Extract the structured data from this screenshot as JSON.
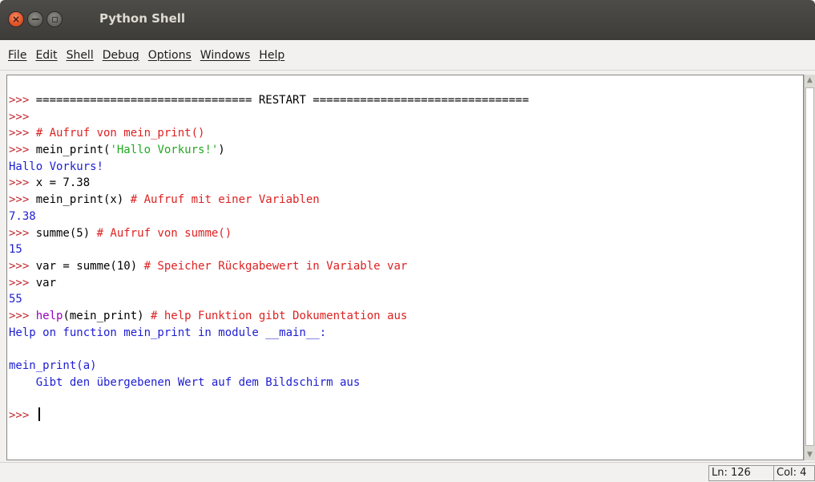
{
  "window": {
    "title": "Python Shell",
    "controls": {
      "close_glyph": "×"
    }
  },
  "menu": [
    {
      "label": "File"
    },
    {
      "label": "Edit"
    },
    {
      "label": "Shell"
    },
    {
      "label": "Debug"
    },
    {
      "label": "Options"
    },
    {
      "label": "Windows"
    },
    {
      "label": "Help"
    }
  ],
  "shell": {
    "lines": [
      [
        {
          "t": ">>> ",
          "c": "prompt"
        },
        {
          "t": "================================ RESTART ================================",
          "c": "code"
        }
      ],
      [
        {
          "t": ">>> ",
          "c": "prompt"
        }
      ],
      [
        {
          "t": ">>> ",
          "c": "prompt"
        },
        {
          "t": "# Aufruf von mein_print()",
          "c": "comment"
        }
      ],
      [
        {
          "t": ">>> ",
          "c": "prompt"
        },
        {
          "t": "mein_print(",
          "c": "code"
        },
        {
          "t": "'Hallo Vorkurs!'",
          "c": "string"
        },
        {
          "t": ")",
          "c": "code"
        }
      ],
      [
        {
          "t": "Hallo Vorkurs!",
          "c": "output"
        }
      ],
      [
        {
          "t": ">>> ",
          "c": "prompt"
        },
        {
          "t": "x = 7.38",
          "c": "code"
        }
      ],
      [
        {
          "t": ">>> ",
          "c": "prompt"
        },
        {
          "t": "mein_print(x) ",
          "c": "code"
        },
        {
          "t": "# Aufruf mit einer Variablen",
          "c": "comment"
        }
      ],
      [
        {
          "t": "7.38",
          "c": "output"
        }
      ],
      [
        {
          "t": ">>> ",
          "c": "prompt"
        },
        {
          "t": "summe(5) ",
          "c": "code"
        },
        {
          "t": "# Aufruf von summe()",
          "c": "comment"
        }
      ],
      [
        {
          "t": "15",
          "c": "output"
        }
      ],
      [
        {
          "t": ">>> ",
          "c": "prompt"
        },
        {
          "t": "var = summe(10) ",
          "c": "code"
        },
        {
          "t": "# Speicher Rückgabewert in Variable var",
          "c": "comment"
        }
      ],
      [
        {
          "t": ">>> ",
          "c": "prompt"
        },
        {
          "t": "var",
          "c": "code"
        }
      ],
      [
        {
          "t": "55",
          "c": "output"
        }
      ],
      [
        {
          "t": ">>> ",
          "c": "prompt"
        },
        {
          "t": "help",
          "c": "builtin"
        },
        {
          "t": "(mein_print) ",
          "c": "code"
        },
        {
          "t": "# help Funktion gibt Dokumentation aus",
          "c": "comment"
        }
      ],
      [
        {
          "t": "Help on function mein_print in module __main__:",
          "c": "output"
        }
      ],
      [],
      [
        {
          "t": "mein_print(a)",
          "c": "output"
        }
      ],
      [
        {
          "t": "    Gibt den übergebenen Wert auf dem Bildschirm aus",
          "c": "output"
        }
      ],
      [],
      [
        {
          "t": ">>> ",
          "c": "prompt"
        }
      ]
    ]
  },
  "status": {
    "line": "Ln: 126",
    "col": "Col: 4"
  },
  "colors": {
    "prompt": "#c1272d",
    "comment": "#dd2222",
    "string": "#22aa22",
    "output": "#1e1ed2",
    "builtin": "#9a00c0",
    "code": "#000000"
  }
}
